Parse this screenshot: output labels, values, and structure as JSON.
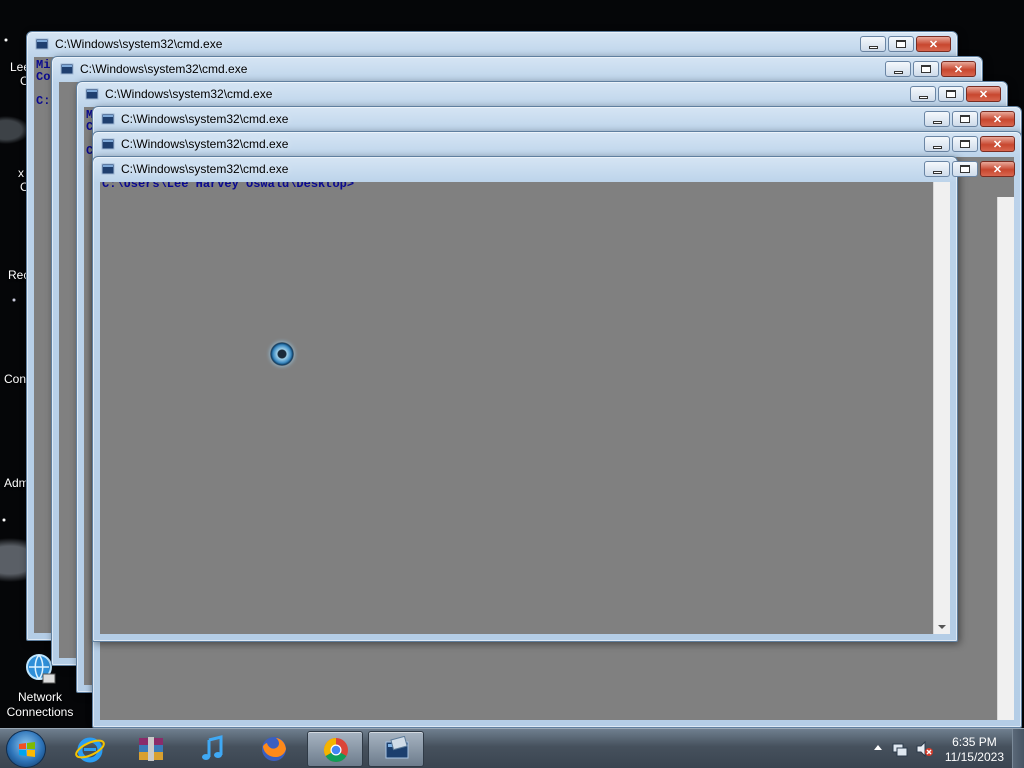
{
  "desktop": {
    "icons": [
      {
        "label": "Network\nConnections"
      }
    ],
    "cut_labels": [
      "Lee",
      "C",
      "x",
      "C",
      "Rec",
      "Con",
      "Adm"
    ]
  },
  "windows": [
    {
      "title": "C:\\Windows\\system32\\cmd.exe",
      "lines": [
        "Mi",
        "Co",
        "",
        "C:"
      ]
    },
    {
      "title": "C:\\Windows\\system32\\cmd.exe",
      "lines": []
    },
    {
      "title": "C:\\Windows\\system32\\cmd.exe",
      "lines": [
        "Mi",
        "Co",
        "",
        "C"
      ]
    },
    {
      "title": "C:\\Windows\\system32\\cmd.exe",
      "lines": []
    },
    {
      "title": "C:\\Windows\\system32\\cmd.exe",
      "lines": []
    },
    {
      "title": "C:\\Windows\\system32\\cmd.exe",
      "lines": [
        "C:\\Users\\Lee Harvey Oswald\\Desktop>"
      ]
    }
  ],
  "window_controls": {
    "minimize": "minimize",
    "maximize": "maximize",
    "close": "✕"
  },
  "taskbar": {
    "apps": [
      {
        "name": "internet-explorer-icon"
      },
      {
        "name": "winrar-icon"
      },
      {
        "name": "itunes-icon"
      },
      {
        "name": "firefox-icon"
      },
      {
        "name": "chrome-icon",
        "active": true
      },
      {
        "name": "cmd-icon",
        "active": true
      }
    ],
    "clock": {
      "time": "6:35 PM",
      "date": "11/15/2023"
    }
  }
}
